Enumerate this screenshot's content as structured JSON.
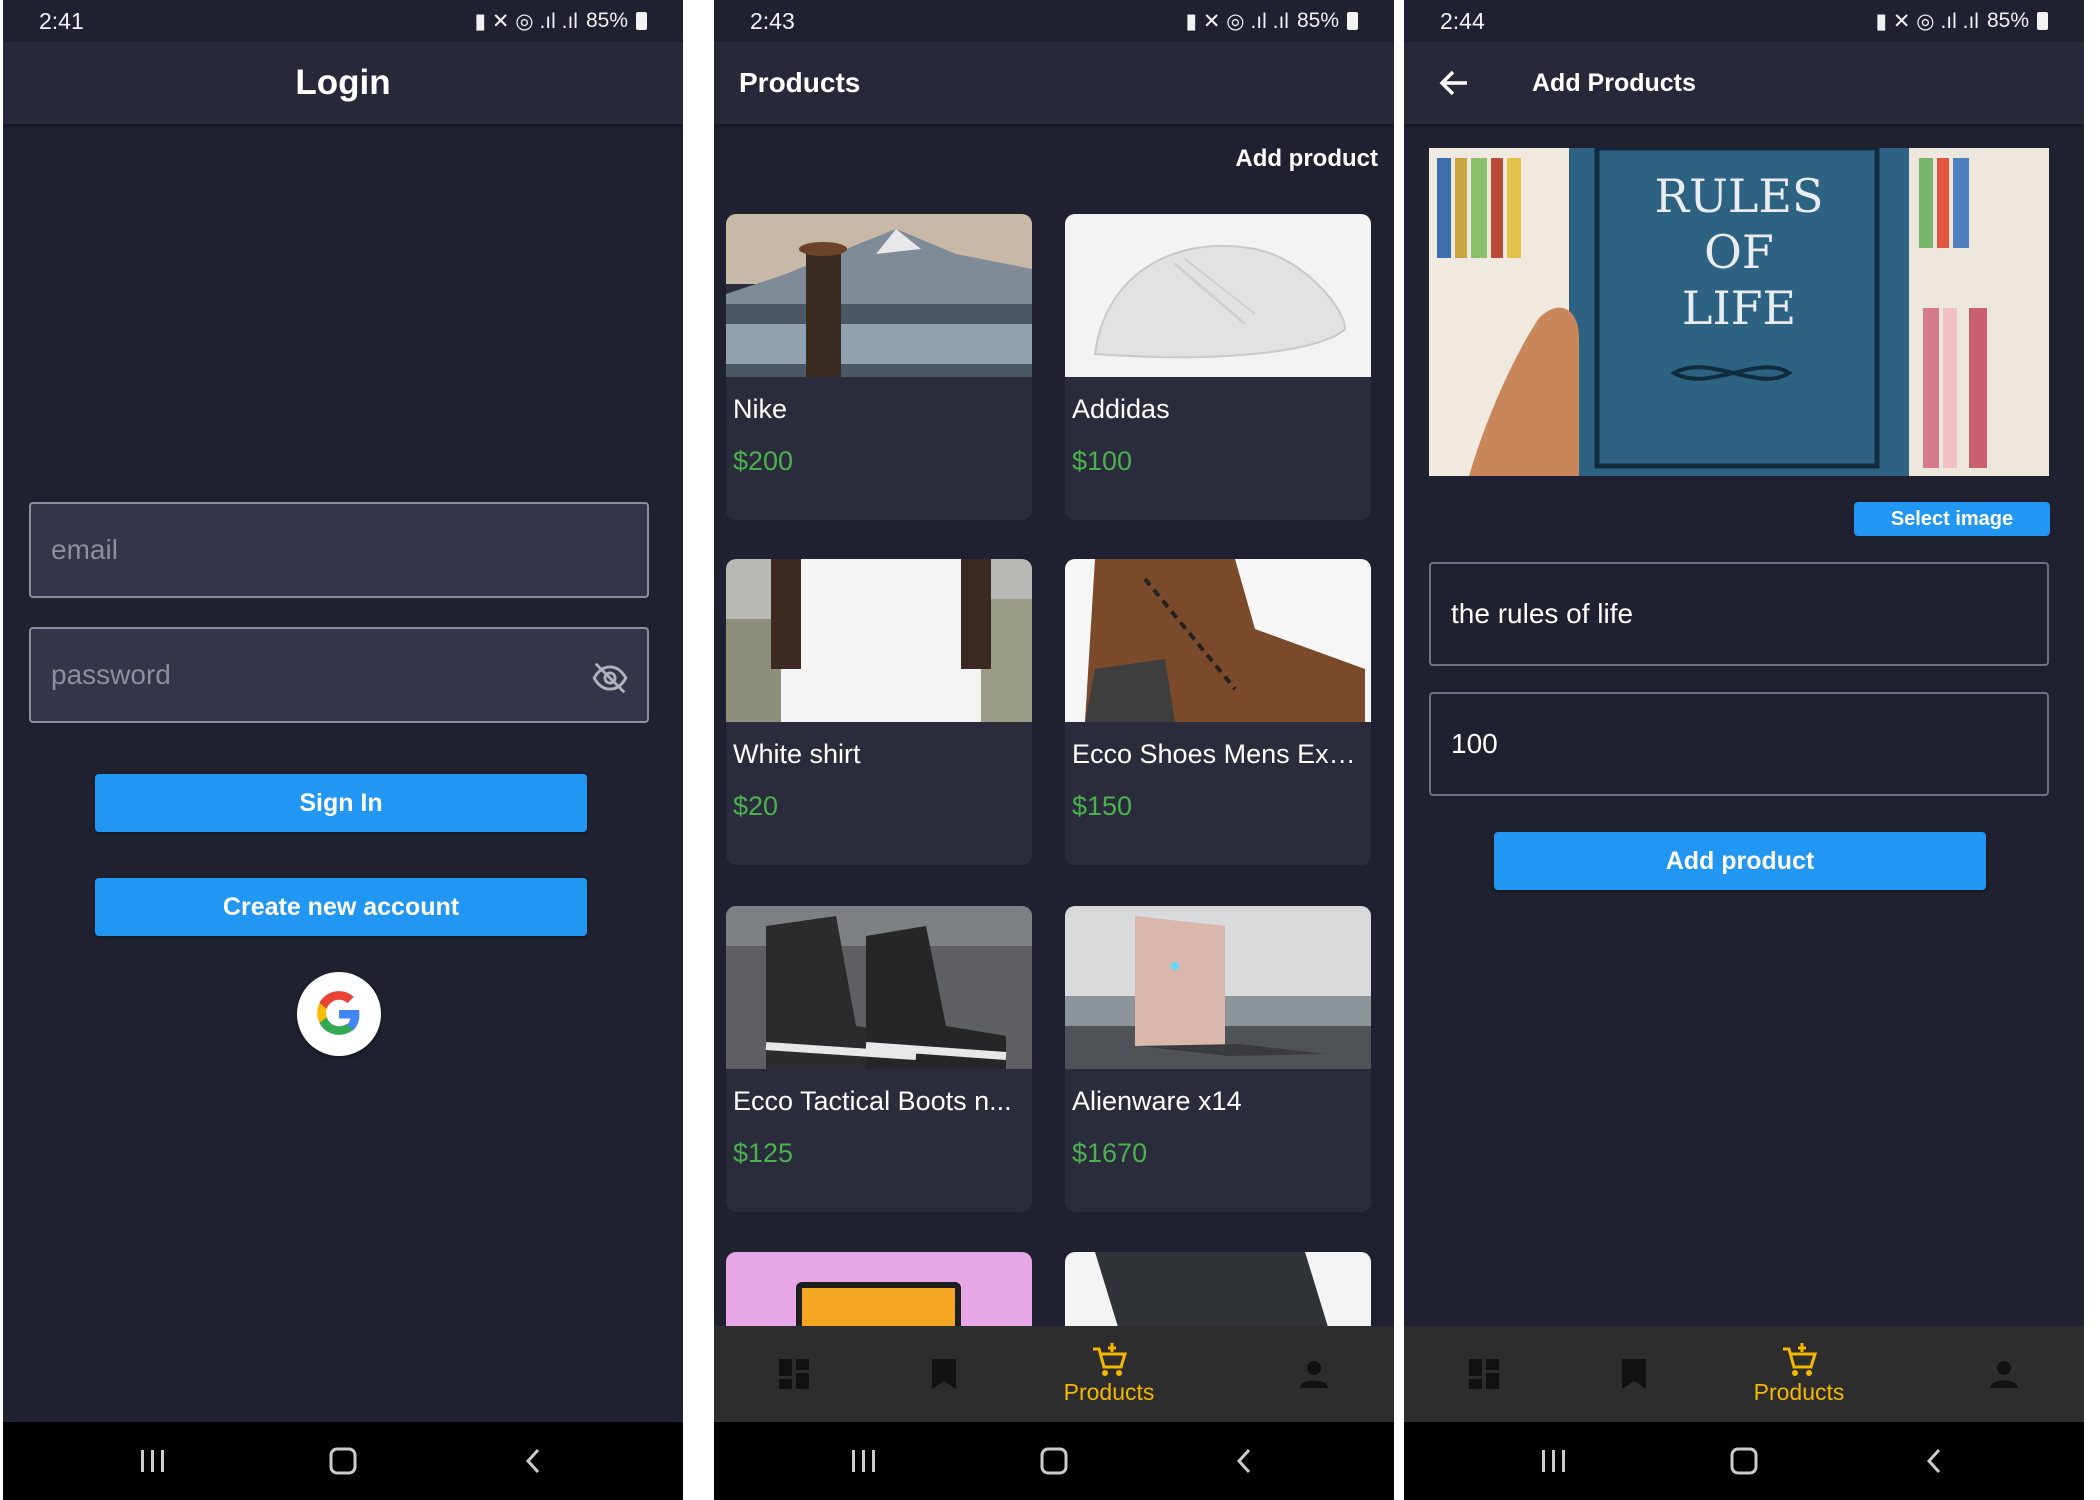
{
  "status_bar": {
    "login_time": "2:41",
    "products_time": "2:43",
    "add_time": "2:44",
    "battery": "85%"
  },
  "login": {
    "title": "Login",
    "email_placeholder": "email",
    "password_placeholder": "password",
    "sign_in_label": "Sign In",
    "create_account_label": "Create new account"
  },
  "products": {
    "title": "Products",
    "add_product_link": "Add product",
    "items": [
      {
        "name": "Nike",
        "price": "$200"
      },
      {
        "name": "Addidas",
        "price": "$100"
      },
      {
        "name": "White shirt",
        "price": "$20"
      },
      {
        "name": "Ecco Shoes Mens Exo...",
        "price": "$150"
      },
      {
        "name": "Ecco Tactical Boots n...",
        "price": "$125"
      },
      {
        "name": "Alienware x14",
        "price": "$1670"
      }
    ]
  },
  "add_products": {
    "title": "Add Products",
    "select_image_label": "Select image",
    "book_text": [
      "RULES",
      "OF",
      "LIFE"
    ],
    "name_value": "the rules of life",
    "price_value": "100",
    "add_button_label": "Add product"
  },
  "bottom_nav": {
    "active_label": "Products",
    "active_color": "#f5b800",
    "icons": [
      "dashboard-icon",
      "bookmark-icon",
      "cart-icon",
      "person-icon"
    ]
  },
  "colors": {
    "background": "#1f2130",
    "appbar": "#27293a",
    "accent": "#2196f3",
    "price": "#4caf50"
  }
}
